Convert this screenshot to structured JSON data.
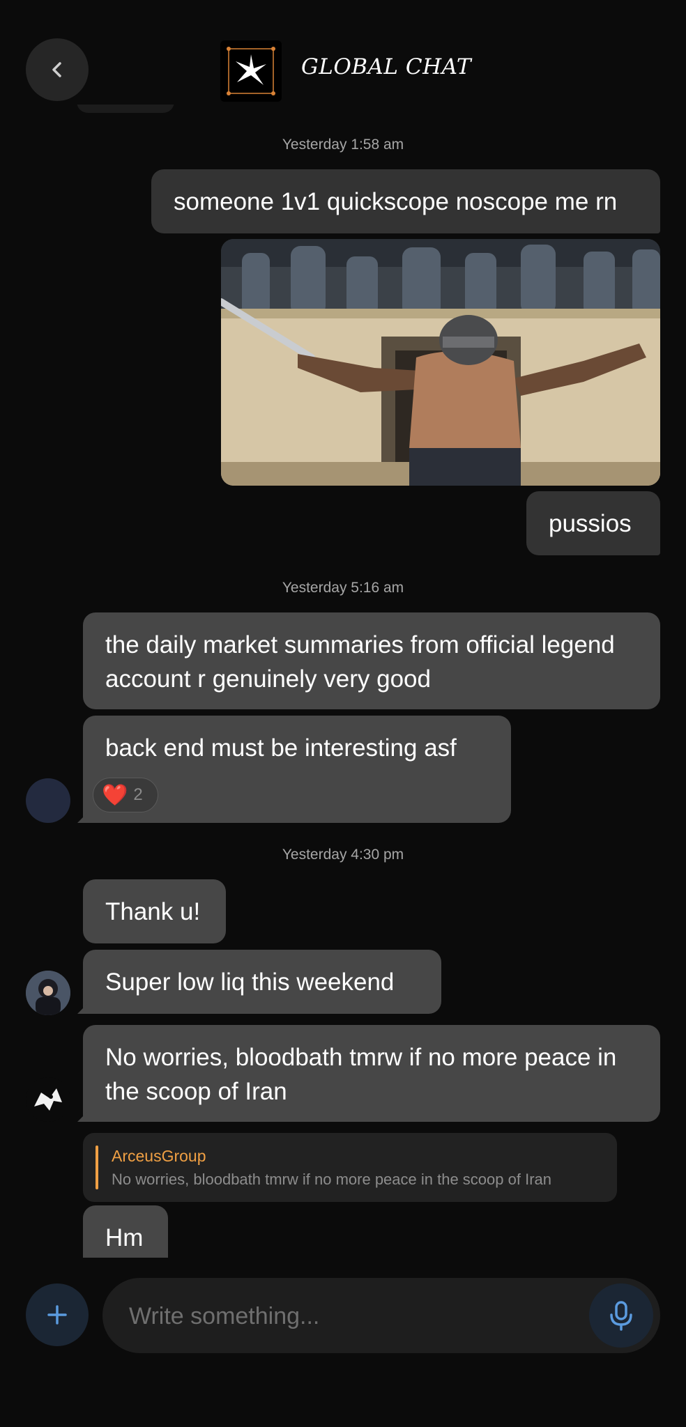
{
  "header": {
    "title": "GLOBAL CHAT",
    "back_icon": "chevron-left-icon",
    "logo_icon": "star-burst-logo"
  },
  "messages": {
    "ts1": "Yesterday 1:58 am",
    "out1": "someone 1v1 quickscope noscope me rn",
    "image_caption": "gladiator image",
    "out2": "pussios",
    "ts2": "Yesterday 5:16 am",
    "in1": "the daily market summaries from official legend account r genuinely very good",
    "in2": "back end must be interesting asf",
    "in2_reaction": {
      "emoji": "❤️",
      "count": "2"
    },
    "ts3": "Yesterday 4:30 pm",
    "in3": "Thank u!",
    "in4": "Super low liq this weekend",
    "in5": "No worries, bloodbath tmrw if no more peace in the scoop of Iran",
    "reply": {
      "author": "ArceusGroup",
      "quoted": "No worries, bloodbath tmrw if no more peace in the scoop of Iran"
    },
    "in6": "Hm"
  },
  "composer": {
    "placeholder": "Write something...",
    "plus_icon": "plus-icon",
    "mic_icon": "microphone-icon"
  },
  "colors": {
    "background": "#0b0b0b",
    "outgoing_bubble": "#333333",
    "incoming_bubble": "#474747",
    "accent_blue": "#5b9bdf",
    "reply_accent": "#f0a044"
  }
}
